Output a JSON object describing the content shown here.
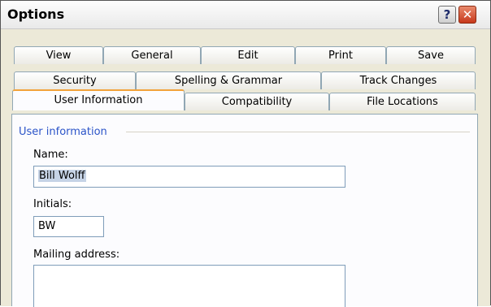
{
  "window": {
    "title": "Options",
    "help_glyph": "?",
    "close_glyph": "✕"
  },
  "tabs": {
    "row1": [
      "View",
      "General",
      "Edit",
      "Print",
      "Save"
    ],
    "row2": [
      "Security",
      "Spelling & Grammar",
      "Track Changes"
    ],
    "row3": [
      "User Information",
      "Compatibility",
      "File Locations"
    ],
    "active": "User Information"
  },
  "user_info": {
    "group_label": "User information",
    "name_label": "Name:",
    "name_value": "Bill Wolff",
    "initials_label": "Initials:",
    "initials_value": "BW",
    "mailing_label": "Mailing address:",
    "mailing_value": ""
  },
  "colors": {
    "group_label_color": "#2b54c8",
    "active_tab_accent": "#f2a33a",
    "close_button": "#c7381b"
  }
}
